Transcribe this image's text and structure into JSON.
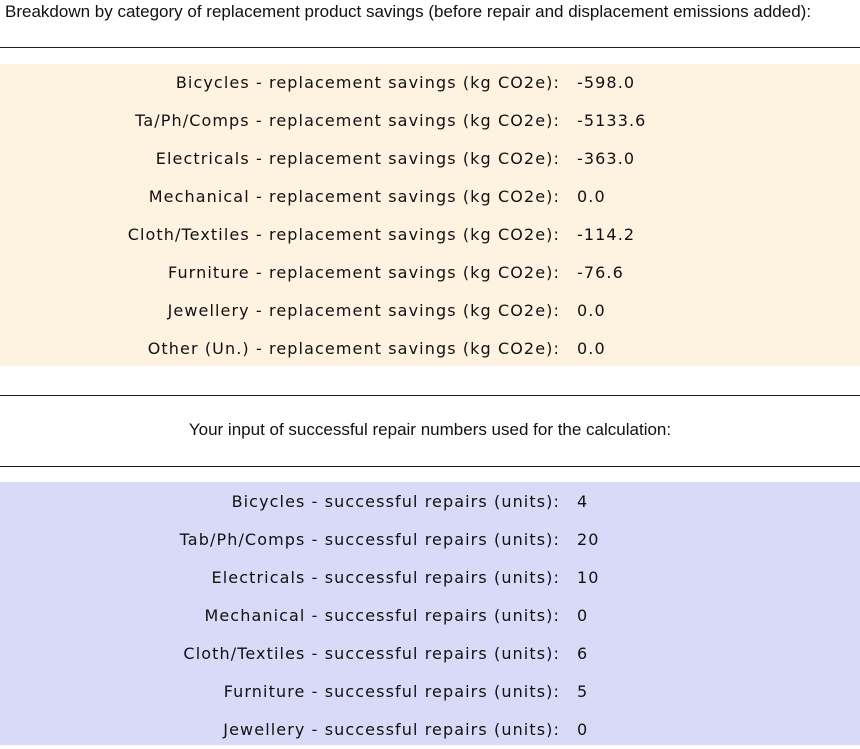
{
  "savings_section": {
    "heading": "Breakdown by category of replacement product savings (before repair and displacement emissions added):",
    "rows": [
      {
        "label": "Bicycles - replacement savings (kg CO2e):",
        "value": "-598.0"
      },
      {
        "label": "Ta/Ph/Comps - replacement savings (kg CO2e):",
        "value": "-5133.6"
      },
      {
        "label": "Electricals - replacement savings (kg CO2e):",
        "value": "-363.0"
      },
      {
        "label": "Mechanical - replacement savings (kg CO2e):",
        "value": "0.0"
      },
      {
        "label": "Cloth/Textiles - replacement savings (kg CO2e):",
        "value": "-114.2"
      },
      {
        "label": "Furniture - replacement savings (kg CO2e):",
        "value": "-76.6"
      },
      {
        "label": "Jewellery - replacement savings (kg CO2e):",
        "value": "0.0"
      },
      {
        "label": "Other (Un.) - replacement savings (kg CO2e):",
        "value": "0.0"
      }
    ]
  },
  "repairs_section": {
    "heading": "Your input of successful repair numbers used for the calculation:",
    "rows": [
      {
        "label": "Bicycles - successful repairs (units):",
        "value": "4"
      },
      {
        "label": "Tab/Ph/Comps - successful repairs (units):",
        "value": "20"
      },
      {
        "label": "Electricals - successful repairs (units):",
        "value": "10"
      },
      {
        "label": "Mechanical - successful repairs (units):",
        "value": "0"
      },
      {
        "label": "Cloth/Textiles - successful repairs (units):",
        "value": "6"
      },
      {
        "label": "Furniture - successful repairs (units):",
        "value": "5"
      },
      {
        "label": "Jewellery - successful repairs (units):",
        "value": "0"
      }
    ]
  }
}
